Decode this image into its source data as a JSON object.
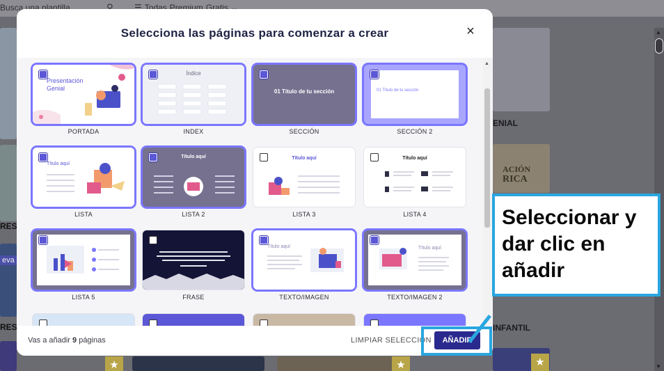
{
  "background": {
    "search_placeholder": "Busca una plantilla",
    "filter_options": [
      "Todas",
      "Premium",
      "Gratis"
    ],
    "side_labels": {
      "left_new_1": "eva",
      "left_new_2": "eva",
      "left_res_1": "RES",
      "left_res_2": "RES",
      "right_card_1": "ENIAL",
      "right_card_2": "INFANTIL",
      "right_card_3_line1": "ACIÓN",
      "right_card_3_line2": "RICA"
    }
  },
  "modal": {
    "title": "Selecciona las páginas para comenzar a crear",
    "close_label": "×",
    "cards": [
      {
        "label": "PORTADA",
        "checked": true,
        "preview_title": "Presentación Genial"
      },
      {
        "label": "INDEX",
        "checked": true,
        "preview_title": "Índice"
      },
      {
        "label": "SECCIÓN",
        "checked": true,
        "preview_title": "01 Título de tu sección"
      },
      {
        "label": "SECCIÓN 2",
        "checked": true,
        "preview_title": "01 Título de tu sección"
      },
      {
        "label": "LISTA",
        "checked": true,
        "preview_title": "Título aquí"
      },
      {
        "label": "LISTA 2",
        "checked": true,
        "preview_title": "Título aquí"
      },
      {
        "label": "LISTA 3",
        "checked": false,
        "preview_title": "Título aquí"
      },
      {
        "label": "LISTA 4",
        "checked": false,
        "preview_title": "Título aquí"
      },
      {
        "label": "LISTA 5",
        "checked": true,
        "preview_title": ""
      },
      {
        "label": "FRASE",
        "checked": false,
        "preview_title": ""
      },
      {
        "label": "TEXTO/IMAGEN",
        "checked": true,
        "preview_title": "Título aquí"
      },
      {
        "label": "TEXTO/IMAGEN 2",
        "checked": true,
        "preview_title": "Título aquí"
      }
    ],
    "footer": {
      "count_prefix": "Vas a añadir ",
      "count": "9",
      "count_suffix": " páginas",
      "clear_label": "LIMPIAR SELECCIÓN",
      "add_label": "AÑADIR"
    }
  },
  "annotation": {
    "text": "Seleccionar y dar clic en añadir",
    "color": "#29a6df"
  },
  "colors": {
    "accent": "#5b57d6",
    "primary_button": "#2a2a8e",
    "selected_border": "#7b76ff",
    "title_text": "#1f2344"
  }
}
